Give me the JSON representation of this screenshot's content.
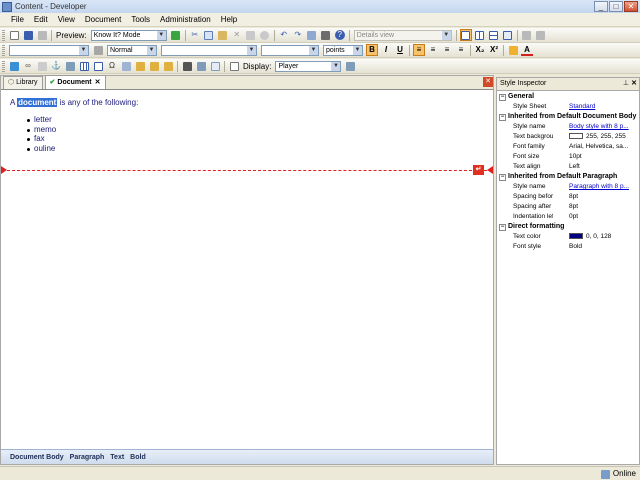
{
  "window": {
    "title": "Content - Developer"
  },
  "menu": [
    "File",
    "Edit",
    "View",
    "Document",
    "Tools",
    "Administration",
    "Help"
  ],
  "toolbar1": {
    "preview_label": "Preview:",
    "preview_mode": "Know It? Mode",
    "view_mode": "Details view"
  },
  "toolbar2": {
    "style": "Normal",
    "units": "points"
  },
  "toolbar3": {
    "display_label": "Display:",
    "display_value": "Player"
  },
  "tabs": [
    {
      "label": "Library"
    },
    {
      "label": "Document"
    }
  ],
  "document": {
    "para_before": "A ",
    "para_highlight": "document",
    "para_after": " is any of the following:",
    "list": [
      "letter",
      "memo",
      "fax",
      "ouline"
    ]
  },
  "breadcrumb": [
    "Document Body",
    "Paragraph",
    "Text",
    "Bold"
  ],
  "inspector": {
    "title": "Style Inspector",
    "sections": [
      {
        "title": "General",
        "rows": [
          {
            "name": "Style Sheet",
            "value": "Standard",
            "link": true
          }
        ]
      },
      {
        "title": "Inherited from Default Document Body",
        "rows": [
          {
            "name": "Style name",
            "value": "Body style with 8 p...",
            "link": true
          },
          {
            "name": "Text background c",
            "value": "255, 255, 255",
            "swatch": "#ffffff"
          },
          {
            "name": "Font family",
            "value": "Arial, Helvetica, sa..."
          },
          {
            "name": "Font size",
            "value": "10pt"
          },
          {
            "name": "Text align",
            "value": "Left"
          }
        ]
      },
      {
        "title": "Inherited from Default Paragraph",
        "rows": [
          {
            "name": "Style name",
            "value": "Paragraph with 8 p...",
            "link": true
          },
          {
            "name": "Spacing before",
            "value": "8pt"
          },
          {
            "name": "Spacing after",
            "value": "8pt"
          },
          {
            "name": "Indentation left",
            "value": "0pt"
          }
        ]
      },
      {
        "title": "Direct formatting",
        "rows": [
          {
            "name": "Text color",
            "value": "0, 0, 128",
            "swatch": "#000080"
          },
          {
            "name": "Font style",
            "value": "Bold"
          }
        ]
      }
    ]
  },
  "status": {
    "connection": "Online"
  }
}
